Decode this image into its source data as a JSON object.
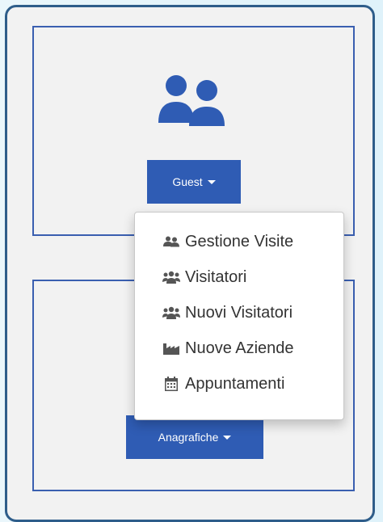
{
  "guest_card": {
    "icon": "users-icon",
    "button_label": "Guest",
    "accent_color": "#2f5cb4"
  },
  "anagrafiche_card": {
    "button_label": "Anagrafiche"
  },
  "dropdown": {
    "items": [
      {
        "label": "Gestione Visite",
        "icon": "users-icon"
      },
      {
        "label": "Visitatori",
        "icon": "user-group-icon"
      },
      {
        "label": "Nuovi Visitatori",
        "icon": "user-group-icon"
      },
      {
        "label": "Nuove Aziende",
        "icon": "industry-icon"
      },
      {
        "label": "Appuntamenti",
        "icon": "calendar-icon"
      }
    ]
  }
}
